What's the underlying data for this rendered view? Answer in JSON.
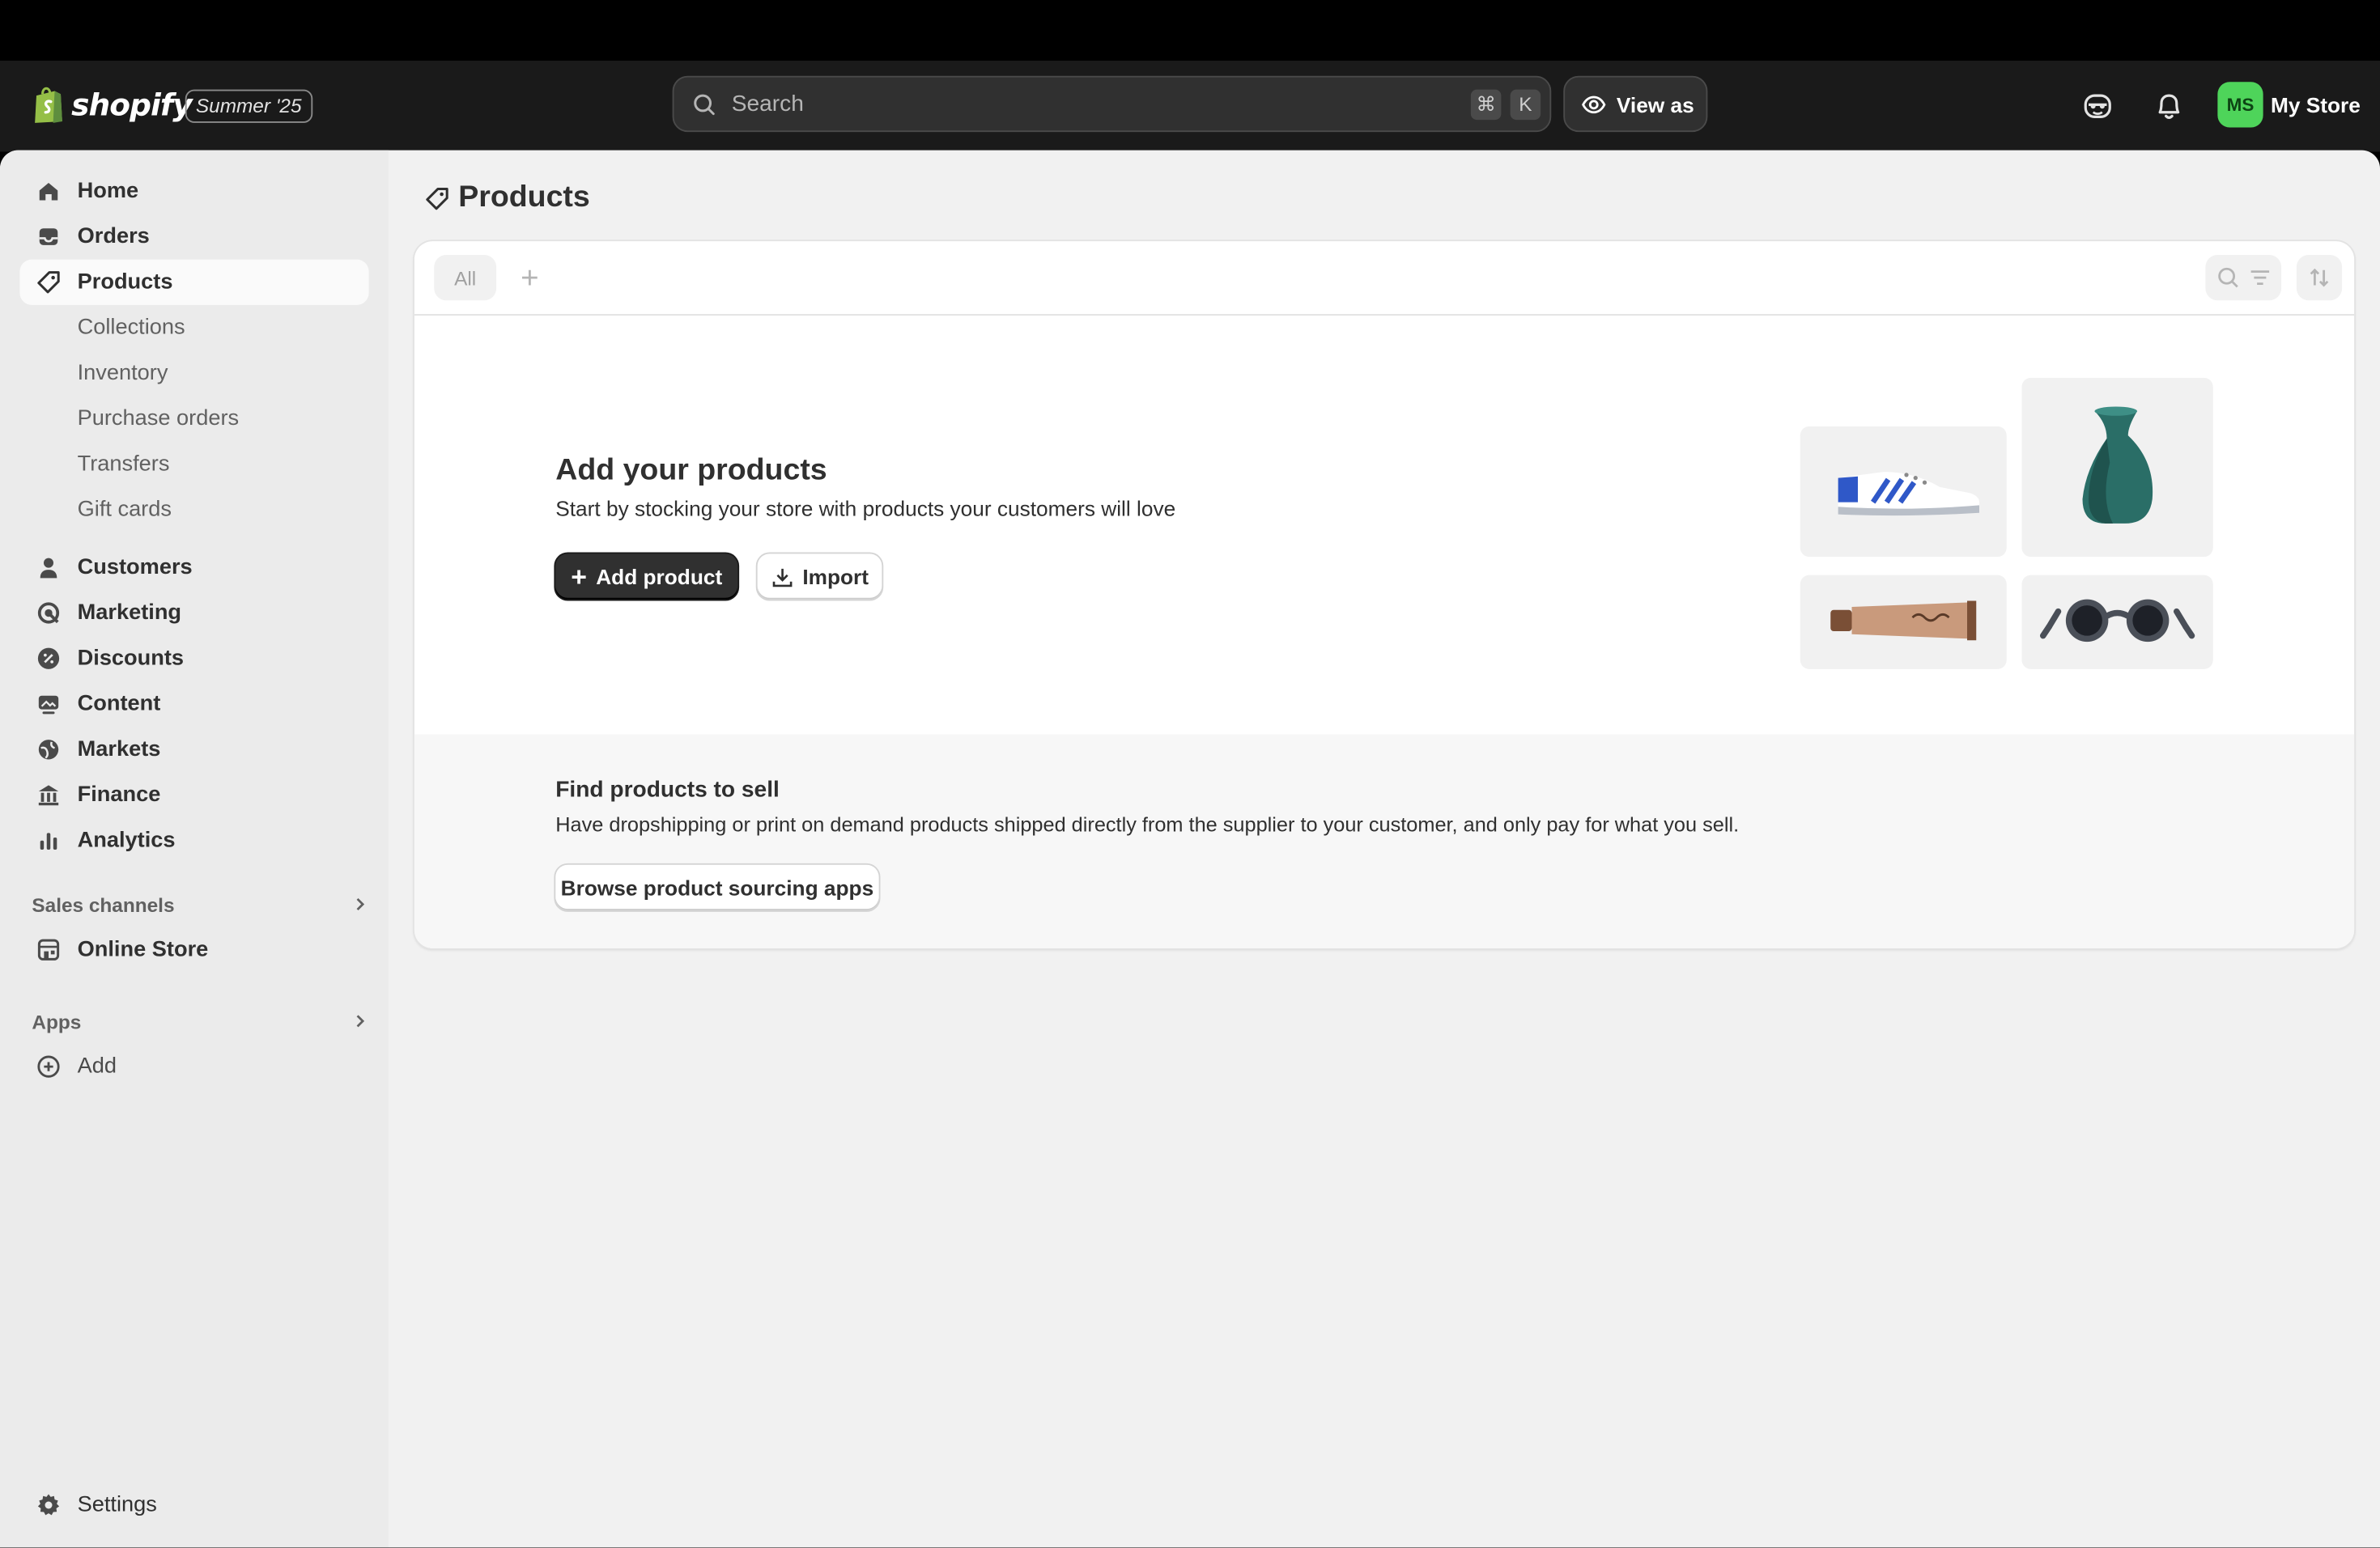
{
  "topbar": {
    "logo_text": "shopify",
    "edition_badge": "Summer '25",
    "search": {
      "placeholder": "Search",
      "shortcut_cmd": "⌘",
      "shortcut_key": "K"
    },
    "view_as_label": "View as",
    "store": {
      "initials": "MS",
      "name": "My Store",
      "avatar_color": "#4ed45a"
    }
  },
  "sidebar": {
    "items": [
      {
        "label": "Home",
        "icon": "home-icon"
      },
      {
        "label": "Orders",
        "icon": "inbox-icon"
      },
      {
        "label": "Products",
        "icon": "tag-icon",
        "active": true
      }
    ],
    "product_subitems": [
      "Collections",
      "Inventory",
      "Purchase orders",
      "Transfers",
      "Gift cards"
    ],
    "items2": [
      {
        "label": "Customers",
        "icon": "person-icon"
      },
      {
        "label": "Marketing",
        "icon": "target-icon"
      },
      {
        "label": "Discounts",
        "icon": "discount-icon"
      },
      {
        "label": "Content",
        "icon": "image-icon"
      },
      {
        "label": "Markets",
        "icon": "globe-icon"
      },
      {
        "label": "Finance",
        "icon": "bank-icon"
      },
      {
        "label": "Analytics",
        "icon": "bar-chart-icon"
      }
    ],
    "sales_channels_label": "Sales channels",
    "online_store_label": "Online Store",
    "apps_label": "Apps",
    "add_label": "Add",
    "settings_label": "Settings"
  },
  "main": {
    "page_title": "Products",
    "tabs": {
      "all_label": "All"
    },
    "empty_state": {
      "title": "Add your products",
      "subtitle": "Start by stocking your store with products your customers will love",
      "add_product_label": "Add product",
      "import_label": "Import"
    },
    "find_products": {
      "title": "Find products to sell",
      "subtitle": "Have dropshipping or print on demand products shipped directly from the supplier to your customer, and only pay for what you sell.",
      "button_label": "Browse product sourcing apps"
    }
  },
  "colors": {
    "topbar_bg": "#1a1a1a",
    "primary_button": "#303030",
    "sidebar_bg": "#ebebeb",
    "page_bg": "#f1f1f1"
  }
}
